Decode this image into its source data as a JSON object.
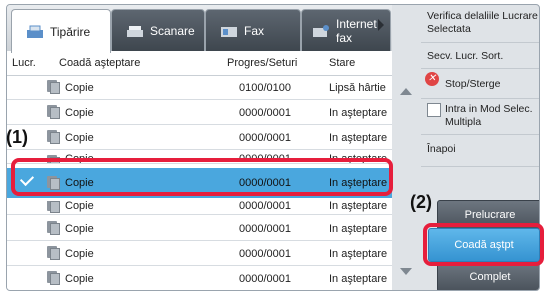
{
  "tabs": [
    {
      "label": "Tipărire",
      "icon": "print-icon",
      "active": true
    },
    {
      "label": "Scanare",
      "icon": "scan-icon",
      "active": false
    },
    {
      "label": "Fax",
      "icon": "fax-icon",
      "active": false
    },
    {
      "label": "Internet fax",
      "icon": "internet-fax-icon",
      "active": false
    }
  ],
  "table": {
    "headers": {
      "job": "Lucr.",
      "queue": "Coadă aşteptare",
      "progress": "Progres/Seturi",
      "status": "Stare"
    },
    "rows": [
      {
        "name": "Copie",
        "progress": "0100/0100",
        "status": "Lipsă hârtie"
      },
      {
        "name": "Copie",
        "progress": "0000/0001",
        "status": "In aşteptare"
      },
      {
        "name": "Copie",
        "progress": "0000/0001",
        "status": "In aşteptare"
      },
      {
        "name": "Copie",
        "progress": "0000/0001",
        "status": "In aşteptare"
      },
      {
        "name": "Copie",
        "progress": "0000/0001",
        "status": "In aşteptare",
        "selected": true
      },
      {
        "name": "Copie",
        "progress": "0000/0001",
        "status": "In aşteptare"
      },
      {
        "name": "Copie",
        "progress": "0000/0001",
        "status": "In aşteptare"
      },
      {
        "name": "Copie",
        "progress": "0000/0001",
        "status": "In aşteptare"
      },
      {
        "name": "Copie",
        "progress": "0000/0001",
        "status": "In aşteptare"
      }
    ]
  },
  "panel": {
    "verify": "Verifica delaliile Lucrare Selectata",
    "sort": "Secv. Lucr. Sort.",
    "stop": "Stop/Sterge",
    "multi": "Intra in Mod Selec. Multipla",
    "back": "Înapoi",
    "process": "Prelucrare",
    "queue": "Coadă aştpt",
    "complete": "Complet"
  },
  "callouts": {
    "one": "(1)",
    "two": "(2)"
  },
  "colors": {
    "highlight": "#e61e3c",
    "selected_row": "#4aa7de",
    "accent_button": "#3593d1"
  }
}
